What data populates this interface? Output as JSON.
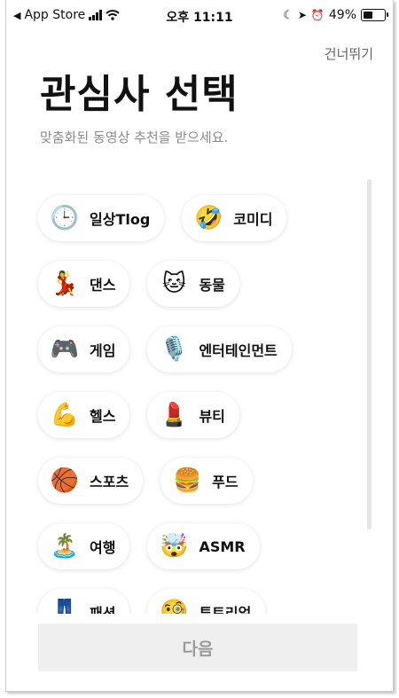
{
  "status_bar": {
    "back_app": "App Store",
    "time": "오후 11:11",
    "battery": "49%",
    "battery_level": 0.49
  },
  "header": {
    "skip_label": "건너뛰기",
    "title": "관심사 선택",
    "subtitle": "맞춤화된 동영상 추천을 받으세요."
  },
  "interests": [
    {
      "label": "일상Tlog",
      "emoji": "🕒",
      "icon": "clock-icon"
    },
    {
      "label": "코미디",
      "emoji": "🤣",
      "icon": "laughing-face-icon"
    },
    {
      "label": "댄스",
      "emoji": "💃",
      "icon": "dancer-icon"
    },
    {
      "label": "동물",
      "emoji": "🐱",
      "icon": "cat-face-icon"
    },
    {
      "label": "게임",
      "emoji": "🎮",
      "icon": "game-controller-icon"
    },
    {
      "label": "엔터테인먼트",
      "emoji": "🎙️",
      "icon": "microphone-icon"
    },
    {
      "label": "헬스",
      "emoji": "💪",
      "icon": "flexed-biceps-icon"
    },
    {
      "label": "뷰티",
      "emoji": "💄",
      "icon": "lipstick-icon"
    },
    {
      "label": "스포츠",
      "emoji": "🏀",
      "icon": "basketball-icon"
    },
    {
      "label": "푸드",
      "emoji": "🍔",
      "icon": "hamburger-icon"
    },
    {
      "label": "여행",
      "emoji": "🏝️",
      "icon": "beach-umbrella-icon"
    },
    {
      "label": "ASMR",
      "emoji": "🤯",
      "icon": "head-emoji-icon"
    },
    {
      "label": "패션",
      "emoji": "👖",
      "icon": "jeans-icon"
    },
    {
      "label": "튜토리얼",
      "emoji": "🧐",
      "icon": "monocle-face-icon"
    }
  ],
  "footer": {
    "next_label": "다음"
  }
}
